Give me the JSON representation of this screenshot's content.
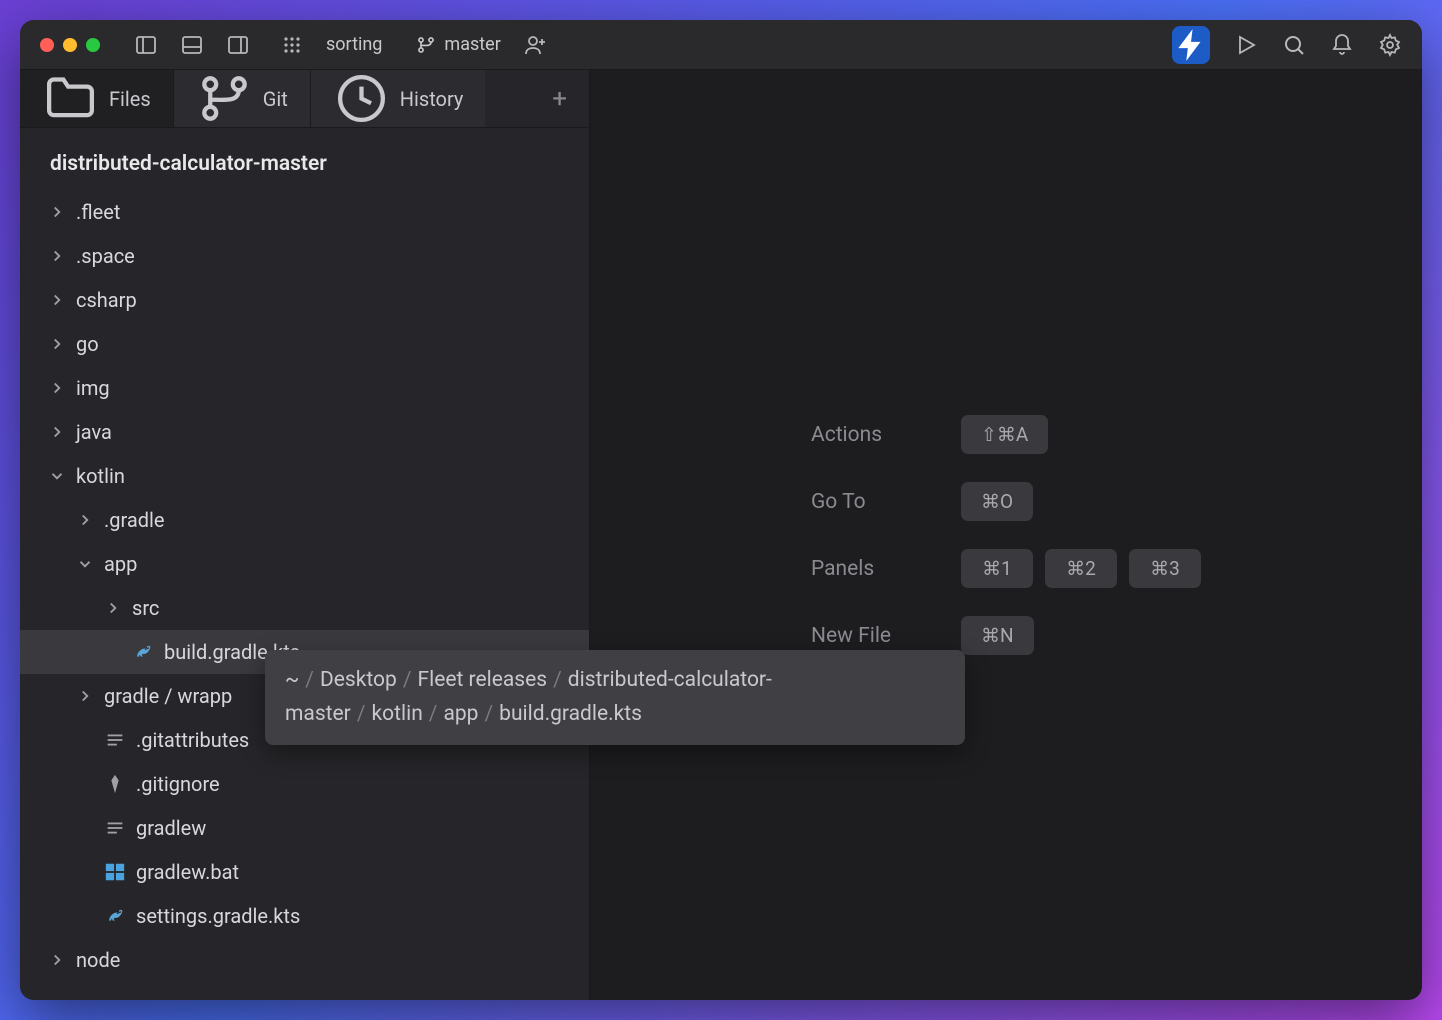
{
  "titlebar": {
    "project": "sorting",
    "branch": "master"
  },
  "tabs": {
    "files": "Files",
    "git": "Git",
    "history": "History"
  },
  "tree": {
    "root": "distributed-calculator-master",
    "nodes": [
      {
        "indent": 0,
        "icon": "chev",
        "label": ".fleet"
      },
      {
        "indent": 0,
        "icon": "chev",
        "label": ".space"
      },
      {
        "indent": 0,
        "icon": "chev",
        "label": "csharp"
      },
      {
        "indent": 0,
        "icon": "chev",
        "label": "go"
      },
      {
        "indent": 0,
        "icon": "chev",
        "label": "img"
      },
      {
        "indent": 0,
        "icon": "chev",
        "label": "java"
      },
      {
        "indent": 0,
        "icon": "chev-down",
        "label": "kotlin"
      },
      {
        "indent": 1,
        "icon": "chev",
        "label": ".gradle"
      },
      {
        "indent": 1,
        "icon": "chev-down",
        "label": "app"
      },
      {
        "indent": 2,
        "icon": "chev",
        "label": "src"
      },
      {
        "indent": 2,
        "icon": "gradle",
        "label": "build.gradle.kts",
        "selected": true
      },
      {
        "indent": 1,
        "icon": "chev",
        "label": "gradle / wrapp"
      },
      {
        "indent": 1,
        "icon": "text",
        "label": ".gitattributes"
      },
      {
        "indent": 1,
        "icon": "diamond",
        "label": ".gitignore"
      },
      {
        "indent": 1,
        "icon": "text",
        "label": "gradlew"
      },
      {
        "indent": 1,
        "icon": "windows",
        "label": "gradlew.bat"
      },
      {
        "indent": 1,
        "icon": "gradle",
        "label": "settings.gradle.kts"
      },
      {
        "indent": 0,
        "icon": "chev",
        "label": "node"
      }
    ]
  },
  "hints": {
    "actions": {
      "label": "Actions",
      "key": "⇧⌘A"
    },
    "goto": {
      "label": "Go To",
      "key": "⌘O"
    },
    "panels": {
      "label": "Panels",
      "keys": [
        "⌘1",
        "⌘2",
        "⌘3"
      ]
    },
    "newfile": {
      "label": "New File",
      "key": "⌘N"
    }
  },
  "tooltip": {
    "segments": [
      "~",
      "Desktop",
      "Fleet releases",
      "distributed-calculator-master",
      "kotlin",
      "app",
      "build.gradle.kts"
    ]
  }
}
